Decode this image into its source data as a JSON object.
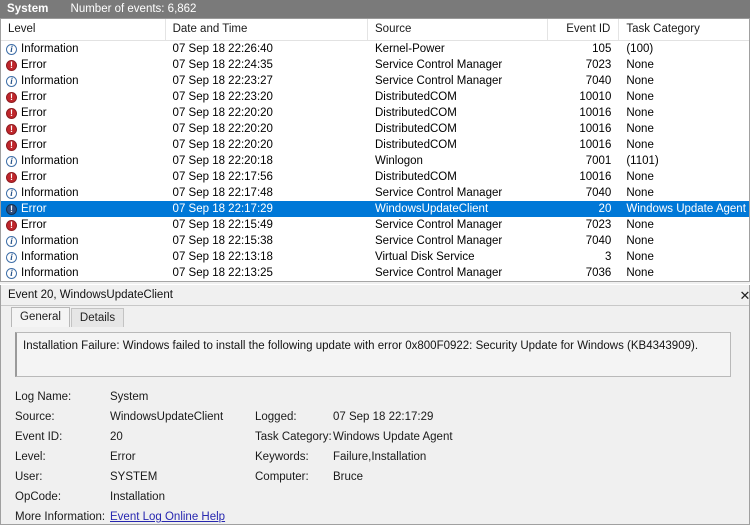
{
  "status_bar": {
    "log_name": "System",
    "event_count_label": "Number of events: 6,862"
  },
  "colors": {
    "selection": "#0078D7",
    "status_bar_bg": "#7A7A7A",
    "error_icon": "#C0262B",
    "information_icon": "#27548A",
    "link": "#2727B0"
  },
  "event_list": {
    "columns": [
      {
        "key": "level",
        "label": "Level"
      },
      {
        "key": "datetime",
        "label": "Date and Time"
      },
      {
        "key": "source",
        "label": "Source"
      },
      {
        "key": "event_id",
        "label": "Event ID"
      },
      {
        "key": "task",
        "label": "Task Category"
      }
    ],
    "rows": [
      {
        "level": "Information",
        "icon": "information-icon",
        "datetime": "07 Sep 18 22:26:40",
        "source": "Kernel-Power",
        "event_id": "105",
        "task": "(100)",
        "selected": false
      },
      {
        "level": "Error",
        "icon": "error-icon",
        "datetime": "07 Sep 18 22:24:35",
        "source": "Service Control Manager",
        "event_id": "7023",
        "task": "None",
        "selected": false
      },
      {
        "level": "Information",
        "icon": "information-icon",
        "datetime": "07 Sep 18 22:23:27",
        "source": "Service Control Manager",
        "event_id": "7040",
        "task": "None",
        "selected": false
      },
      {
        "level": "Error",
        "icon": "error-icon",
        "datetime": "07 Sep 18 22:23:20",
        "source": "DistributedCOM",
        "event_id": "10010",
        "task": "None",
        "selected": false
      },
      {
        "level": "Error",
        "icon": "error-icon",
        "datetime": "07 Sep 18 22:20:20",
        "source": "DistributedCOM",
        "event_id": "10016",
        "task": "None",
        "selected": false
      },
      {
        "level": "Error",
        "icon": "error-icon",
        "datetime": "07 Sep 18 22:20:20",
        "source": "DistributedCOM",
        "event_id": "10016",
        "task": "None",
        "selected": false
      },
      {
        "level": "Error",
        "icon": "error-icon",
        "datetime": "07 Sep 18 22:20:20",
        "source": "DistributedCOM",
        "event_id": "10016",
        "task": "None",
        "selected": false
      },
      {
        "level": "Information",
        "icon": "information-icon",
        "datetime": "07 Sep 18 22:20:18",
        "source": "Winlogon",
        "event_id": "7001",
        "task": "(1101)",
        "selected": false
      },
      {
        "level": "Error",
        "icon": "error-icon",
        "datetime": "07 Sep 18 22:17:56",
        "source": "DistributedCOM",
        "event_id": "10016",
        "task": "None",
        "selected": false
      },
      {
        "level": "Information",
        "icon": "information-icon",
        "datetime": "07 Sep 18 22:17:48",
        "source": "Service Control Manager",
        "event_id": "7040",
        "task": "None",
        "selected": false
      },
      {
        "level": "Error",
        "icon": "error-icon",
        "datetime": "07 Sep 18 22:17:29",
        "source": "WindowsUpdateClient",
        "event_id": "20",
        "task": "Windows Update Agent",
        "selected": true
      },
      {
        "level": "Error",
        "icon": "error-icon",
        "datetime": "07 Sep 18 22:15:49",
        "source": "Service Control Manager",
        "event_id": "7023",
        "task": "None",
        "selected": false
      },
      {
        "level": "Information",
        "icon": "information-icon",
        "datetime": "07 Sep 18 22:15:38",
        "source": "Service Control Manager",
        "event_id": "7040",
        "task": "None",
        "selected": false
      },
      {
        "level": "Information",
        "icon": "information-icon",
        "datetime": "07 Sep 18 22:13:18",
        "source": "Virtual Disk Service",
        "event_id": "3",
        "task": "None",
        "selected": false
      },
      {
        "level": "Information",
        "icon": "information-icon",
        "datetime": "07 Sep 18 22:13:25",
        "source": "Service Control Manager",
        "event_id": "7036",
        "task": "None",
        "selected": false
      }
    ]
  },
  "detail": {
    "title": "Event 20, WindowsUpdateClient",
    "close_label": "✕",
    "tabs": [
      {
        "label": "General",
        "active": true
      },
      {
        "label": "Details",
        "active": false
      }
    ],
    "message": "Installation Failure: Windows failed to install the following update with error 0x800F0922: Security Update for Windows (KB4343909).",
    "fields_left": [
      {
        "label": "Log Name:",
        "value": "System"
      },
      {
        "label": "Source:",
        "value": "WindowsUpdateClient"
      },
      {
        "label": "Event ID:",
        "value": "20"
      },
      {
        "label": "Level:",
        "value": "Error"
      },
      {
        "label": "User:",
        "value": "SYSTEM"
      },
      {
        "label": "OpCode:",
        "value": "Installation"
      }
    ],
    "fields_right": [
      {
        "label": "Logged:",
        "value": "07 Sep 18 22:17:29"
      },
      {
        "label": "Task Category:",
        "value": "Windows Update Agent"
      },
      {
        "label": "Keywords:",
        "value": "Failure,Installation"
      },
      {
        "label": "Computer:",
        "value": "Bruce"
      }
    ],
    "more_information_label": "More Information:",
    "more_information_link": "Event Log Online Help"
  }
}
